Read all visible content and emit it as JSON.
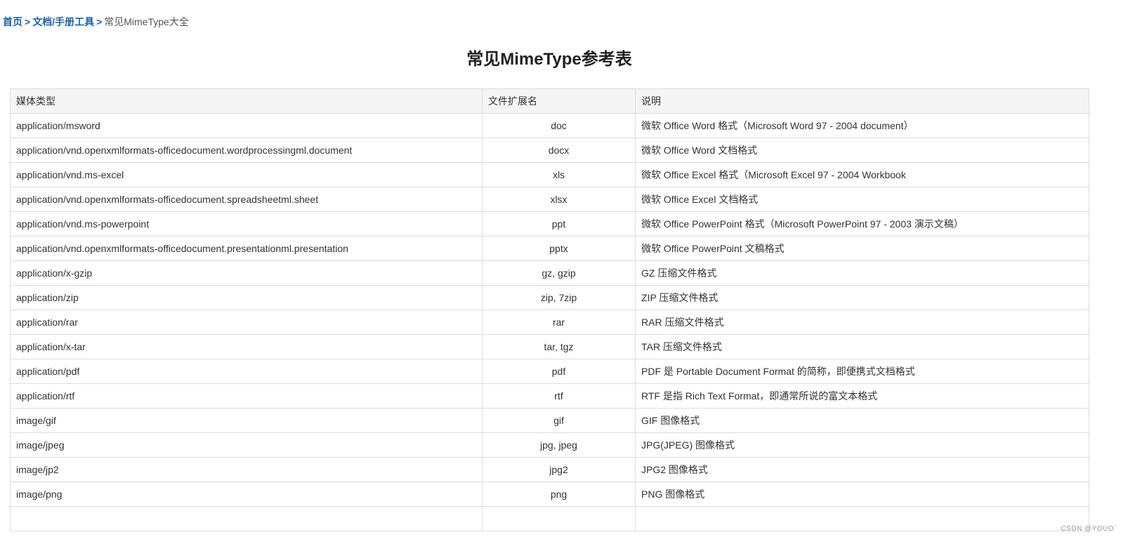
{
  "breadcrumb": {
    "home": "首页",
    "separator": ">",
    "category": "文档/手册工具",
    "current": "常见MimeType大全"
  },
  "title": "常见MimeType参考表",
  "table": {
    "headers": [
      "媒体类型",
      "文件扩展名",
      "说明"
    ],
    "rows": [
      [
        "application/msword",
        "doc",
        "微软 Office Word 格式（Microsoft Word 97 - 2004 document）"
      ],
      [
        "application/vnd.openxmlformats-officedocument.wordprocessingml.document",
        "docx",
        "微软 Office Word 文档格式"
      ],
      [
        "application/vnd.ms-excel",
        "xls",
        "微软 Office Excel 格式（Microsoft Excel 97 - 2004 Workbook"
      ],
      [
        "application/vnd.openxmlformats-officedocument.spreadsheetml.sheet",
        "xlsx",
        "微软 Office Excel 文档格式"
      ],
      [
        "application/vnd.ms-powerpoint",
        "ppt",
        "微软 Office PowerPoint 格式（Microsoft PowerPoint 97 - 2003 演示文稿）"
      ],
      [
        "application/vnd.openxmlformats-officedocument.presentationml.presentation",
        "pptx",
        "微软 Office PowerPoint 文稿格式"
      ],
      [
        "application/x-gzip",
        "gz, gzip",
        "GZ 压缩文件格式"
      ],
      [
        "application/zip",
        "zip, 7zip",
        "ZIP 压缩文件格式"
      ],
      [
        "application/rar",
        "rar",
        "RAR 压缩文件格式"
      ],
      [
        "application/x-tar",
        "tar, tgz",
        "TAR 压缩文件格式"
      ],
      [
        "application/pdf",
        "pdf",
        "PDF 是 Portable Document Format 的简称，即便携式文档格式"
      ],
      [
        "application/rtf",
        "rtf",
        "RTF 是指 Rich Text Format，即通常所说的富文本格式"
      ],
      [
        "image/gif",
        "gif",
        "GIF 图像格式"
      ],
      [
        "image/jpeg",
        "jpg, jpeg",
        "JPG(JPEG) 图像格式"
      ],
      [
        "image/jp2",
        "jpg2",
        "JPG2 图像格式"
      ],
      [
        "image/png",
        "png",
        "PNG 图像格式"
      ],
      [
        "",
        "",
        ""
      ]
    ]
  },
  "watermark": "CSDN @YOUO`",
  "colors": {
    "link": "#1a63a8",
    "header_bg": "#f5f5f5",
    "border": "#dddddd",
    "text": "#333333"
  }
}
